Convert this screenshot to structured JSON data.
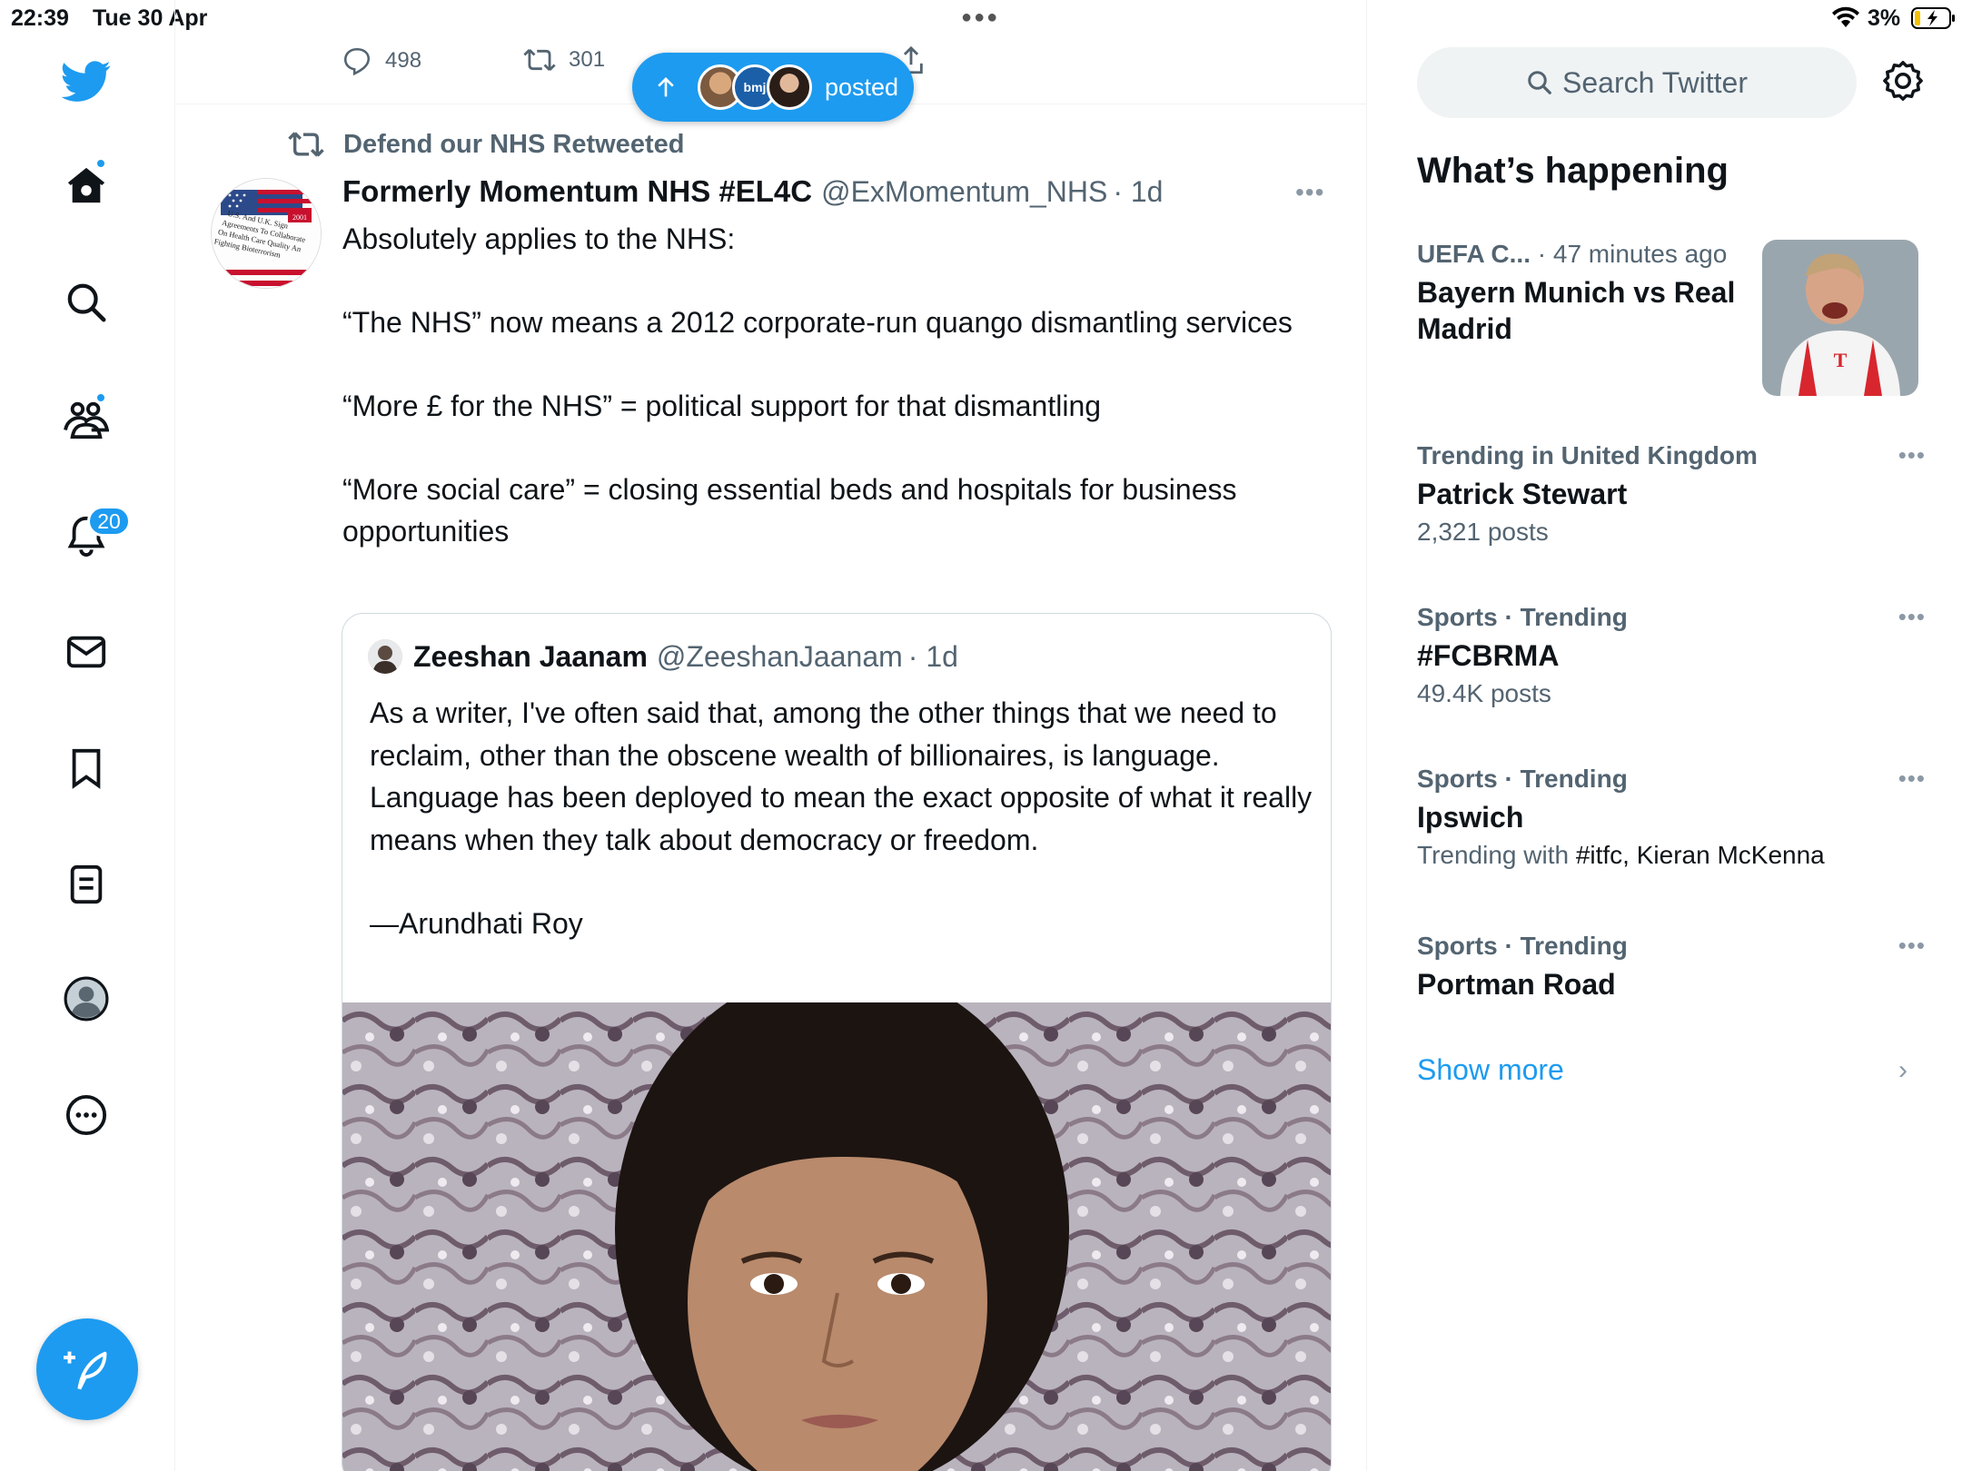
{
  "status_bar": {
    "time": "22:39",
    "date": "Tue 30 Apr",
    "battery_pct": "3%"
  },
  "left_nav": {
    "items": [
      {
        "name": "home",
        "icon": "home-icon"
      },
      {
        "name": "explore",
        "icon": "search-icon"
      },
      {
        "name": "communities",
        "icon": "communities-icon"
      },
      {
        "name": "notifications",
        "icon": "bell-icon"
      },
      {
        "name": "messages",
        "icon": "mail-icon"
      },
      {
        "name": "bookmarks",
        "icon": "bookmark-icon"
      },
      {
        "name": "lists",
        "icon": "lists-icon"
      },
      {
        "name": "profile",
        "icon": "profile-avatar"
      },
      {
        "name": "more",
        "icon": "more-circle-icon"
      }
    ],
    "notifications_badge": "20",
    "accent": "#1d9bf0"
  },
  "previous_tweet_actions": {
    "replies": "498",
    "retweets": "301"
  },
  "new_posts_pill": {
    "label": "posted",
    "avatar_text": "bmj"
  },
  "tweet": {
    "retweeted_by": "Defend our NHS Retweeted",
    "name": "Formerly Momentum NHS #EL4C",
    "handle": "@ExMomentum_NHS",
    "time": "· 1d",
    "avatar_lines": [
      "U.S. And U.K. Sign",
      "Agreements To Collaborate",
      "On Health Care Quality An",
      "Fighting Bioterrorism"
    ],
    "avatar_year": "2001",
    "body": [
      "Absolutely applies to the NHS:",
      "“The NHS” now means a 2012 corporate-run quango dismantling services",
      "“More £ for the NHS” = political support for that dismantling",
      "“More social care” = closing essential beds and hospitals for business opportunities"
    ],
    "quote": {
      "name": "Zeeshan Jaanam",
      "handle": "@ZeeshanJaanam",
      "time": "· 1d",
      "body": [
        "As a writer, I've often said that, among the other things that we need to reclaim, other than the obscene wealth of billionaires, is language. Language has been deployed to mean the exact opposite of what it really means when they talk about democracy or freedom.",
        "—Arundhati Roy"
      ]
    }
  },
  "sidebar": {
    "search_placeholder": "Search Twitter",
    "heading": "What’s happening",
    "trends": [
      {
        "meta_strong": "UEFA C...",
        "meta": " · 47 minutes ago",
        "title": "Bayern Munich vs Real Madrid",
        "sub": "",
        "has_image": true
      },
      {
        "meta_strong": "Trending in United Kingdom",
        "meta": "",
        "title": "Patrick Stewart",
        "sub": "2,321 posts"
      },
      {
        "meta_strong": "Sports",
        "meta": " · Trending",
        "title": "#FCBRMA",
        "sub": "49.4K posts"
      },
      {
        "meta_strong": "Sports",
        "meta": " · Trending",
        "title": "Ipswich",
        "sub_prefix": "Trending with ",
        "sub_rest": "#itfc, Kieran McKenna"
      },
      {
        "meta_strong": "Sports",
        "meta": " · Trending",
        "title": "Portman Road",
        "sub": ""
      }
    ],
    "show_more": "Show more"
  }
}
